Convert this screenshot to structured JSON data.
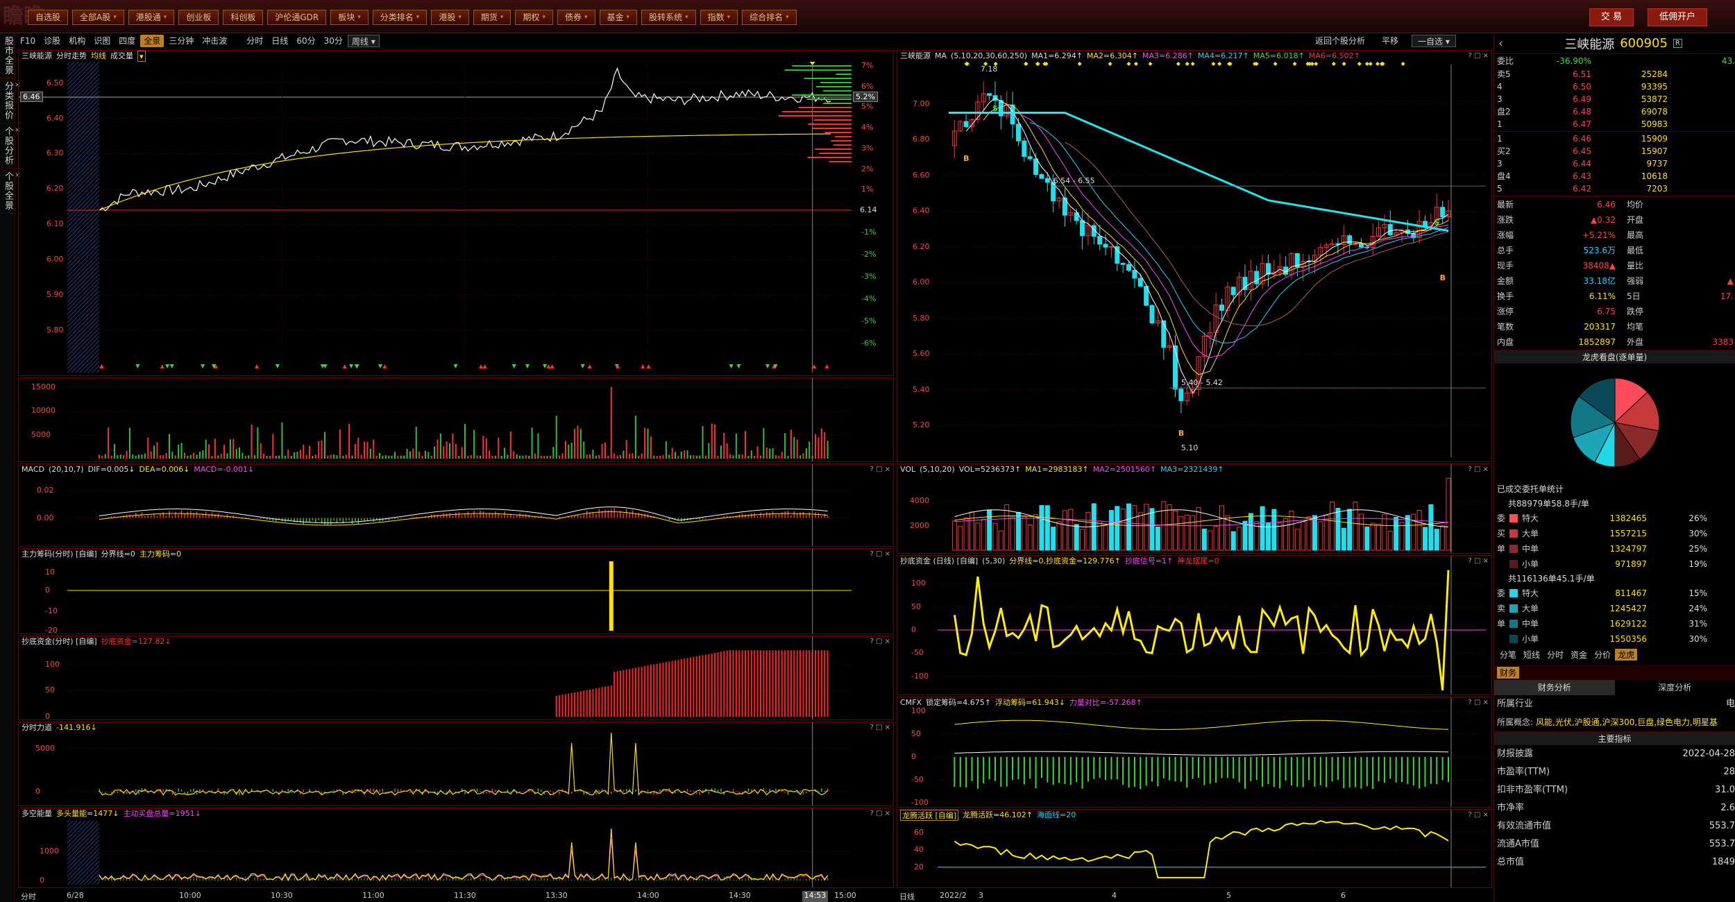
{
  "window_title": "",
  "brand_text": "瞻瞻",
  "menu": [
    {
      "label": "自选股",
      "dd": false
    },
    {
      "label": "全部A股",
      "dd": true
    },
    {
      "label": "港股通",
      "dd": true
    },
    {
      "label": "创业板",
      "dd": false
    },
    {
      "label": "科创板",
      "dd": false
    },
    {
      "label": "沪伦通GDR",
      "dd": false
    },
    {
      "label": "板块",
      "dd": true
    },
    {
      "label": "分类排名",
      "dd": true
    },
    {
      "label": "港股",
      "dd": true
    },
    {
      "label": "期货",
      "dd": true
    },
    {
      "label": "期权",
      "dd": true
    },
    {
      "label": "债券",
      "dd": true
    },
    {
      "label": "基金",
      "dd": true
    },
    {
      "label": "股转系统",
      "dd": true
    },
    {
      "label": "指数",
      "dd": true
    },
    {
      "label": "综合排名",
      "dd": true
    }
  ],
  "right_buttons": {
    "trade": "交 易",
    "open_account": "低佣开户"
  },
  "vtabs": [
    "股市全景",
    "分类报价",
    "个股分析",
    "个股全景"
  ],
  "subbar": [
    "F10",
    "诊股",
    "机构",
    "识图",
    "四度",
    "全景",
    "三分钟",
    "冲击波",
    "分时",
    "日线",
    "60分",
    "30分",
    "周线"
  ],
  "subbar_active": "全景",
  "rightbar": {
    "back": "返回个股分析",
    "flat": "平移",
    "watch": "一自选"
  },
  "intraday": {
    "name": "三峡能源",
    "label_trend": "分时走势",
    "label_avg": "均线",
    "label_vol": "成交量",
    "price_ticks": [
      "6.50",
      "6.40",
      "6.30",
      "6.20",
      "6.10",
      "6.00",
      "5.90",
      "5.80"
    ],
    "cur_price": "6.46",
    "pct_ticks_up": [
      "7%",
      "6%",
      "5%",
      "4%",
      "3%",
      "2%",
      "1%"
    ],
    "pct_cur": "5.2%",
    "pct_ticks_dn": [
      "-1%",
      "-2%",
      "-3%",
      "-4%",
      "-5%",
      "-6%"
    ],
    "base_price": "6.14",
    "vol_ticks": [
      "15000",
      "10000",
      "5000"
    ],
    "macd": {
      "name": "MACD",
      "params": "(20,10,7)",
      "dif": "DIF=0.005↓",
      "dea": "DEA=0.006↓",
      "macd": "MACD=-0.001↓",
      "ticks": [
        "0.02",
        "0.00"
      ]
    },
    "zl": {
      "name": "主力筹码(分时) [自编]",
      "line": "分界线=0",
      "val": "主力筹码=0",
      "ticks": [
        "10",
        "0",
        "-10",
        "-20"
      ]
    },
    "cd": {
      "name": "抄底资金(分时) [自编]",
      "val": "抄底资金=127.82↓",
      "ticks": [
        "100",
        "50",
        "0"
      ]
    },
    "fs": {
      "name": "分时力道",
      "val": "-141.916↓",
      "ticks": [
        "5000",
        "0"
      ]
    },
    "dk": {
      "name": "多空能量",
      "a": "多头量能=1477↓",
      "b": "主动买盘总量=1951↓",
      "ticks": [
        "1000",
        "0"
      ]
    },
    "time_mode": "分时",
    "date": "6/28",
    "times": [
      "10:00",
      "10:30",
      "11:00",
      "11:30",
      "13:30",
      "14:00",
      "14:30"
    ],
    "cursor_time": "14:53",
    "end_time": "15:00"
  },
  "daily": {
    "name": "三峡能源",
    "ma_label": "MA",
    "ma_params": "(5,10,20,30,60,250)",
    "ma": [
      "MA1=6.294↑",
      "MA2=6.304↑",
      "MA3=6.286↑",
      "MA4=6.217↑",
      "MA5=6.018↑",
      "MA6=6.502↑"
    ],
    "price_ticks": [
      "7.00",
      "6.80",
      "6.60",
      "6.40",
      "6.20",
      "6.00",
      "5.80",
      "5.60",
      "5.40",
      "5.20"
    ],
    "annot_high": "7.18",
    "annot_mid": "6.54 - 6.55",
    "annot_low2": "5.40 - 5.42",
    "annot_low": "5.10",
    "vol": {
      "name": "VOL",
      "params": "(5,10,20)",
      "v": "VOL=5236373↑",
      "m1": "MA1=2983183↑",
      "m2": "MA2=2501560↑",
      "m3": "MA3=2321439↑",
      "ticks": [
        "4000",
        "2000"
      ]
    },
    "cd": {
      "name": "抄底资金 (日线) [自编]",
      "params": "(5,30)",
      "a": "分界线=0,抄底资金=129.776↑",
      "b": "抄底信号=1↑",
      "c": "神龙摆尾=0",
      "ticks": [
        "100",
        "50",
        "0",
        "-50",
        "-100"
      ]
    },
    "cmfx": {
      "name": "CMFX",
      "a": "锁定筹码=4.675↑",
      "b": "浮动筹码=61.943↓",
      "c": "力量对比=-57.268↑",
      "ticks": [
        "100",
        "50",
        "0",
        "-50",
        "-100"
      ]
    },
    "lt": {
      "name": "龙腾活跃 [自编]",
      "a": "龙腾活跃=46.102↑",
      "b": "海面线=20",
      "ticks": [
        "60",
        "40",
        "20"
      ]
    },
    "time_mode": "日线",
    "dates": [
      "2022/2",
      "3",
      "4",
      "5",
      "6"
    ]
  },
  "info": {
    "name": "三峡能源",
    "code": "600905",
    "badge": "R",
    "wb_label": "委比",
    "wb_val": "-36.90%",
    "wb_extra": "43.",
    "asks": [
      {
        "k": "卖5",
        "p": "6.51",
        "v": "25284"
      },
      {
        "k": "4",
        "p": "6.50",
        "v": "93395"
      },
      {
        "k": "3",
        "p": "6.49",
        "v": "53872"
      },
      {
        "k": "盘2",
        "p": "6.48",
        "v": "69078"
      },
      {
        "k": "1",
        "p": "6.47",
        "v": "50983"
      }
    ],
    "bids": [
      {
        "k": "1",
        "p": "6.46",
        "v": "15909"
      },
      {
        "k": "买2",
        "p": "6.45",
        "v": "15907"
      },
      {
        "k": "3",
        "p": "6.44",
        "v": "9737"
      },
      {
        "k": "盘4",
        "p": "6.43",
        "v": "10618"
      },
      {
        "k": "5",
        "p": "6.42",
        "v": "7203"
      }
    ],
    "quote": [
      {
        "k": "最新",
        "v": "6.46",
        "k2": "均价",
        "v2": ""
      },
      {
        "k": "涨跌",
        "v": "▲0.32",
        "k2": "开盘",
        "v2": ""
      },
      {
        "k": "涨幅",
        "v": "+5.21%",
        "k2": "最高",
        "v2": ""
      },
      {
        "k": "总手",
        "v": "523.6万",
        "k2": "最低",
        "v2": ""
      },
      {
        "k": "现手",
        "v": "38408▲",
        "k2": "量比",
        "v2": ""
      },
      {
        "k": "金额",
        "v": "33.18亿",
        "k2": "强弱",
        "v2": "▲"
      },
      {
        "k": "换手",
        "v": "6.11%",
        "k2": "5日",
        "v2": "17."
      },
      {
        "k": "涨停",
        "v": "6.75",
        "k2": "跌停",
        "v2": ""
      },
      {
        "k": "笔数",
        "v": "203317",
        "k2": "均笔",
        "v2": ""
      },
      {
        "k": "内盘",
        "v": "1852897",
        "k2": "外盘",
        "v2": "3383"
      }
    ],
    "pie_title": "龙虎看盘(逐单量)",
    "pie": [
      {
        "v": 26,
        "c": "#ff4a5a"
      },
      {
        "v": 30,
        "c": "#c83a3a"
      },
      {
        "v": 25,
        "c": "#8a2a2a"
      },
      {
        "v": 19,
        "c": "#5a1a1a"
      },
      {
        "v": 15,
        "c": "#20d8e8"
      },
      {
        "v": 24,
        "c": "#1aa8b8"
      },
      {
        "v": 31,
        "c": "#127888"
      },
      {
        "v": 30,
        "c": "#0a4858"
      }
    ],
    "order_title": "已成交委托单统计",
    "buy_total": "共88979单58.8手/单",
    "buy_rows": [
      {
        "side": "委",
        "k": "特大",
        "v": "1382465",
        "p": "26%",
        "c": "#ff5050"
      },
      {
        "side": "买",
        "k": "大单",
        "v": "1557215",
        "p": "30%",
        "c": "#c83a3a"
      },
      {
        "side": "单",
        "k": "中单",
        "v": "1324797",
        "p": "25%",
        "c": "#8a2a2a"
      },
      {
        "side": "",
        "k": "小单",
        "v": "971897",
        "p": "19%",
        "c": "#5a1a1a"
      }
    ],
    "sell_total": "共116136单45.1手/单",
    "sell_rows": [
      {
        "side": "委",
        "k": "特大",
        "v": "811467",
        "p": "15%",
        "c": "#20d8e8"
      },
      {
        "side": "卖",
        "k": "大单",
        "v": "1245427",
        "p": "24%",
        "c": "#1aa8b8"
      },
      {
        "side": "单",
        "k": "中单",
        "v": "1629122",
        "p": "31%",
        "c": "#127888"
      },
      {
        "side": "",
        "k": "小单",
        "v": "1550356",
        "p": "30%",
        "c": "#0a4858"
      }
    ],
    "tabs": [
      "分笔",
      "短线",
      "分时",
      "资金",
      "分价",
      "龙虎"
    ],
    "tab_active": "龙虎",
    "fin_tab": "财务",
    "fin_sub1": "财务分析",
    "fin_sub2": "深度分析",
    "industry_k": "所属行业",
    "industry_v": "电",
    "concept_k": "所属概念:",
    "concept_v": "风能,光伏,沪股通,沪深300,巨盘,绿色电力,明星基",
    "main_idx": "主要指标",
    "fin": [
      {
        "k": "财报披露",
        "v": "2022-04-28"
      },
      {
        "k": "市盈率(TTM)",
        "v": "28"
      },
      {
        "k": "扣非市盈率(TTM)",
        "v": "31.0"
      },
      {
        "k": "市净率",
        "v": "2.6"
      },
      {
        "k": "有效流通市值",
        "v": "553.7"
      },
      {
        "k": "流通A市值",
        "v": "553.7"
      },
      {
        "k": "总市值",
        "v": "1849"
      }
    ]
  },
  "colors": {
    "panel_border": "#6a0000",
    "price_line": "#ffffff",
    "avg_line": "#ffe000",
    "up": "#ff3030",
    "down": "#20e8f0"
  }
}
